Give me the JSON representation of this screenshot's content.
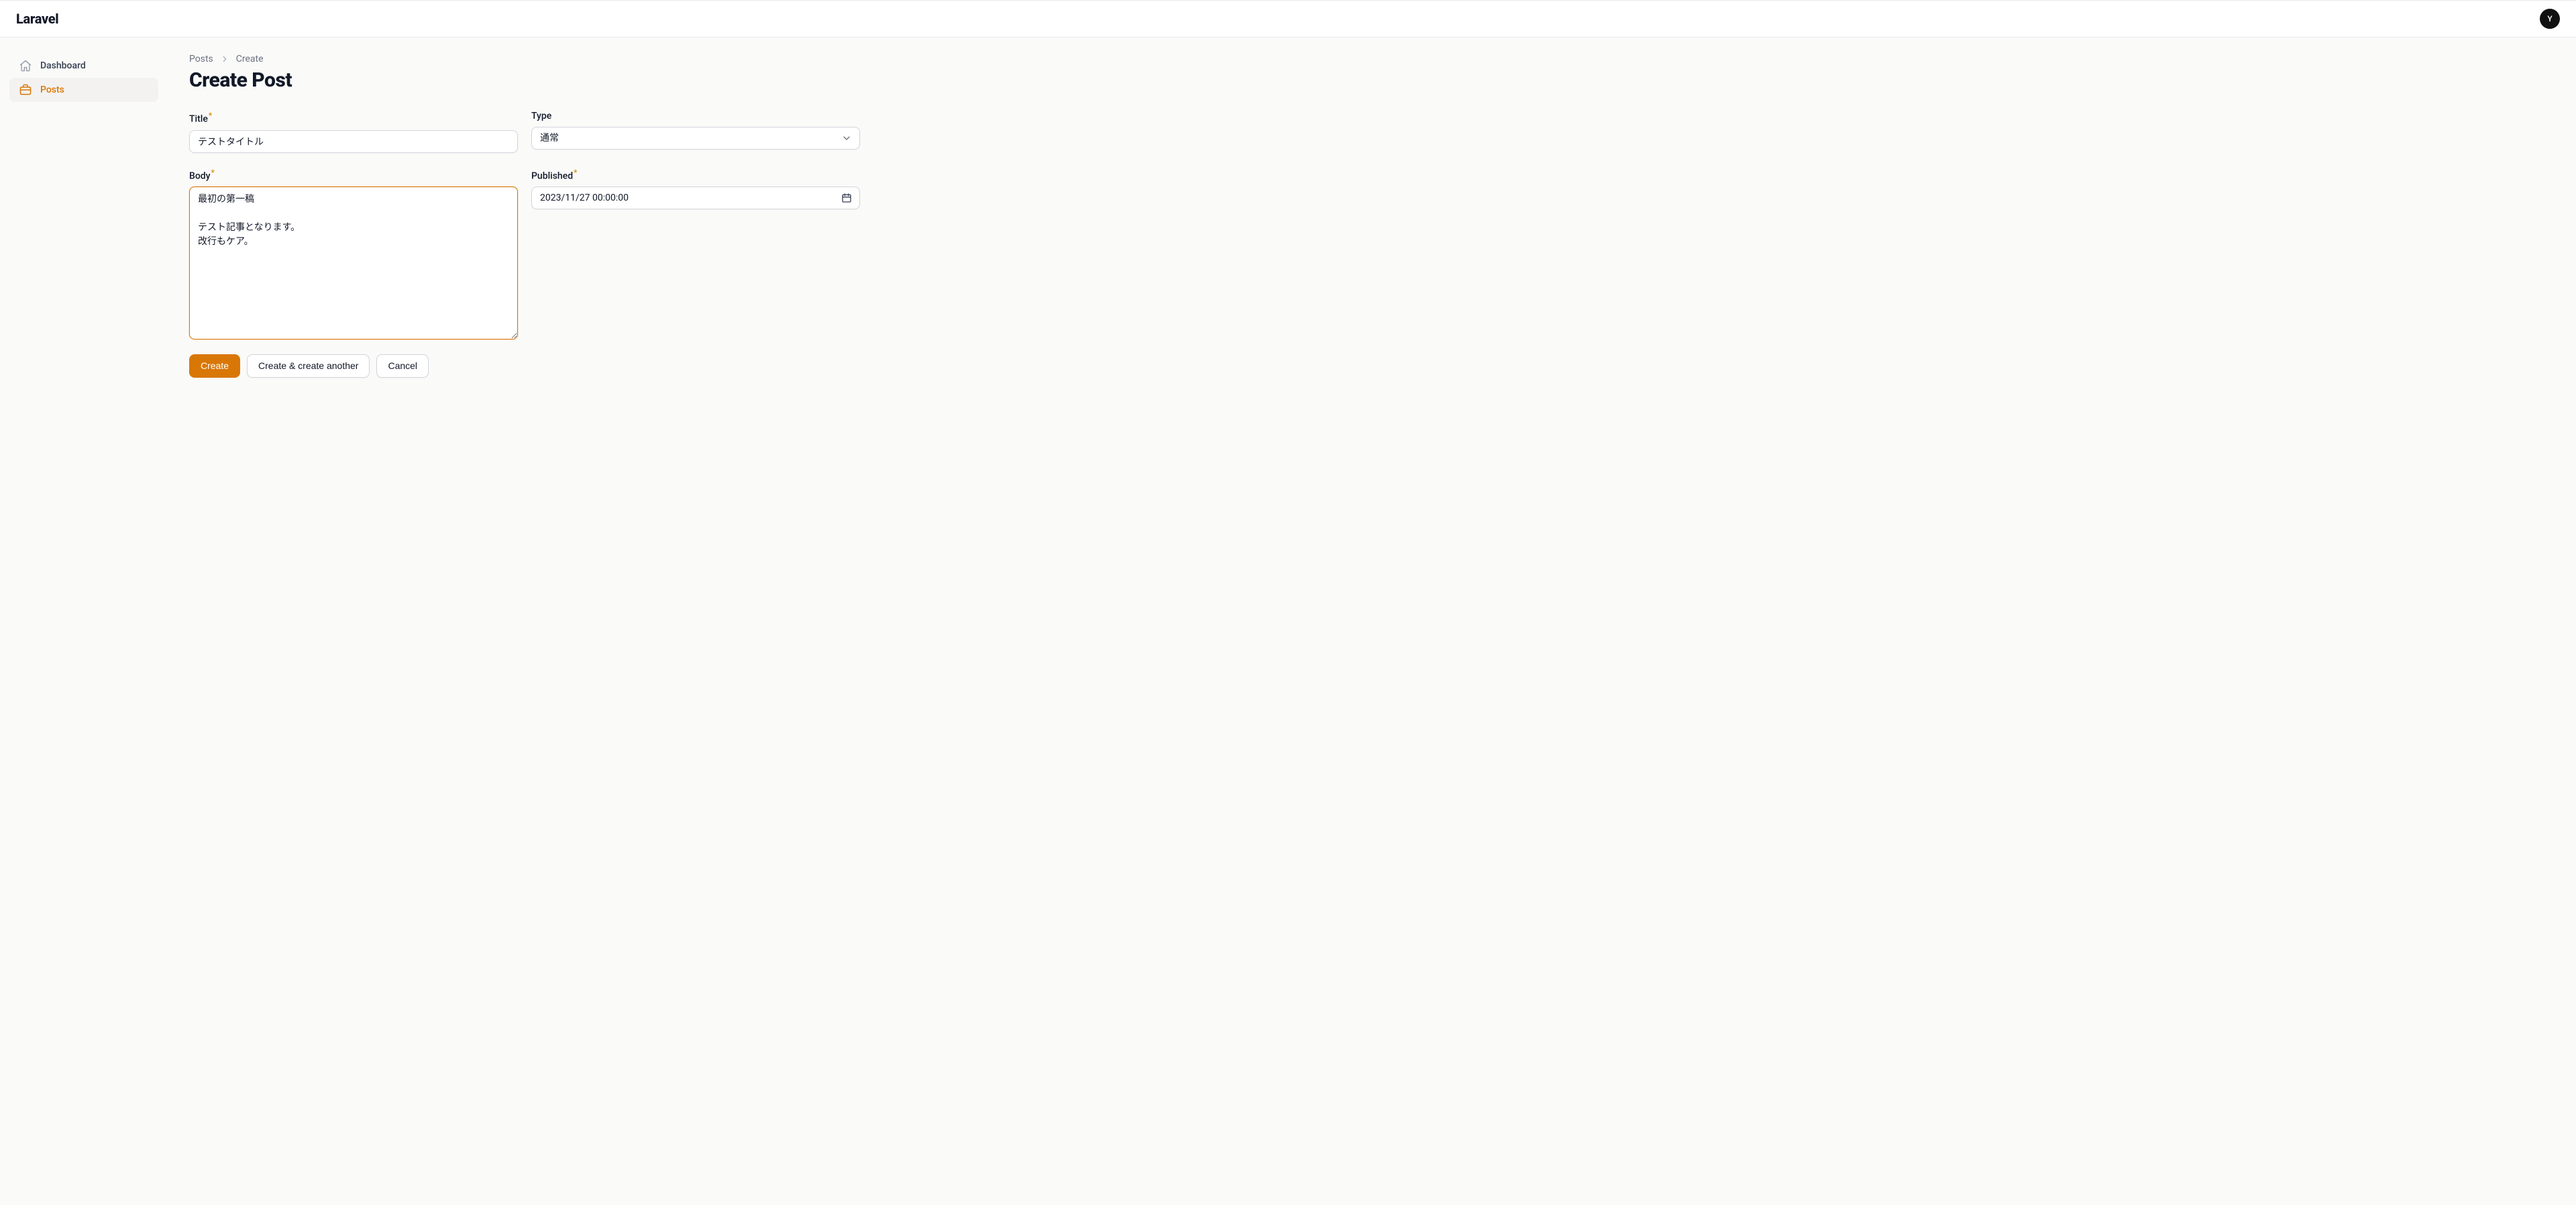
{
  "brand": "Laravel",
  "avatar_initial": "Y",
  "sidebar": {
    "items": [
      {
        "label": "Dashboard",
        "icon": "home",
        "active": false
      },
      {
        "label": "Posts",
        "icon": "briefcase",
        "active": true
      }
    ]
  },
  "breadcrumb": {
    "items": [
      "Posts",
      "Create"
    ]
  },
  "page_title": "Create Post",
  "form": {
    "title": {
      "label": "Title",
      "required": true,
      "value": "テストタイトル"
    },
    "type": {
      "label": "Type",
      "required": false,
      "value": "通常"
    },
    "body": {
      "label": "Body",
      "required": true,
      "value": "最初の第一稿\n\nテスト記事となります。\n改行もケア。"
    },
    "published": {
      "label": "Published",
      "required": true,
      "value": "2023/11/27 00:00:00"
    }
  },
  "actions": {
    "create": "Create",
    "create_another": "Create & create another",
    "cancel": "Cancel"
  },
  "colors": {
    "accent": "#d97706"
  }
}
